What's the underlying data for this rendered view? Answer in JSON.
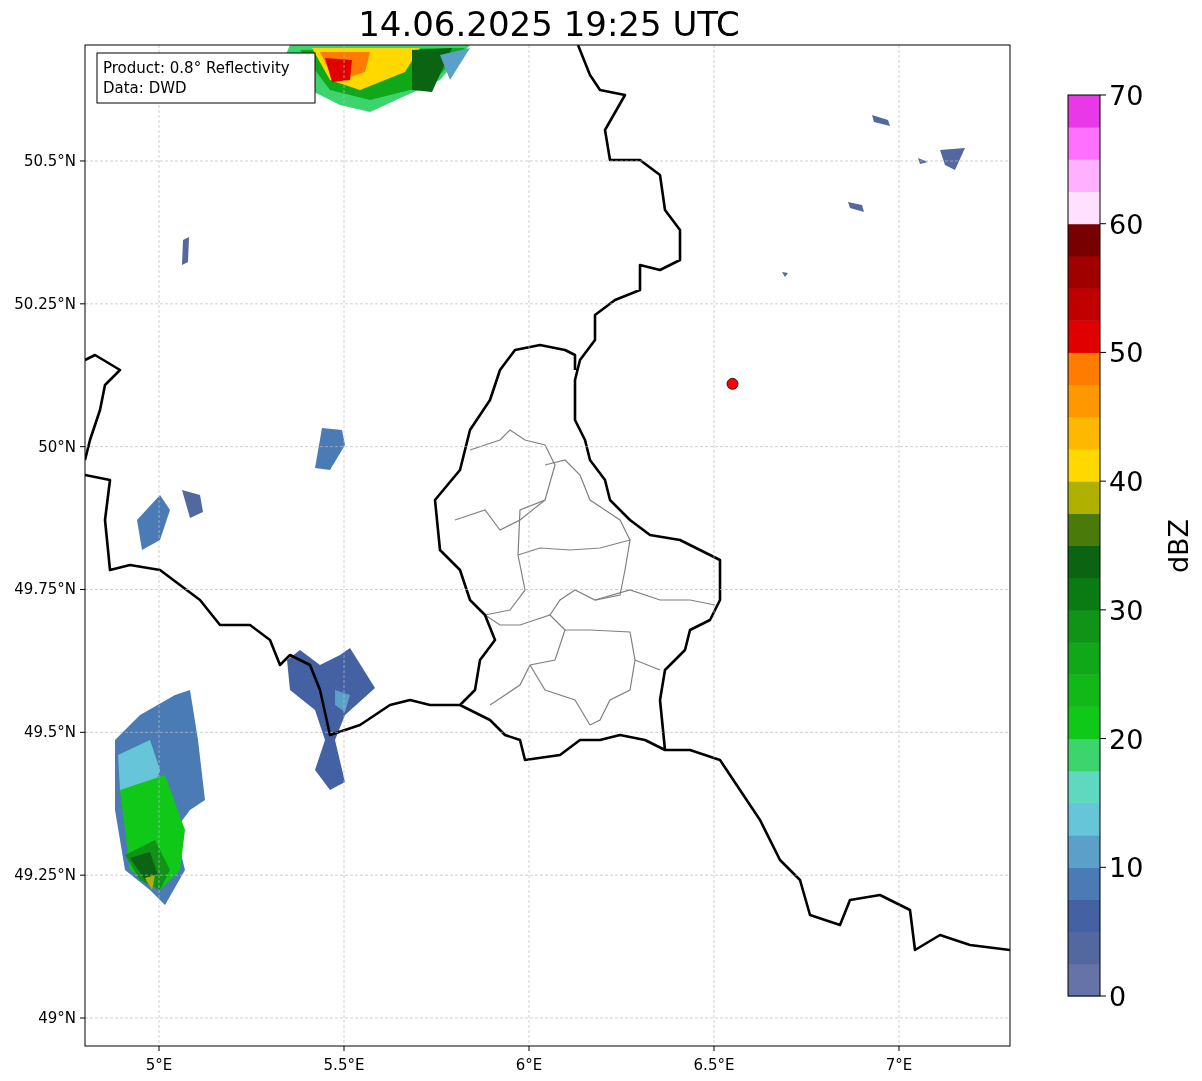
{
  "title": "14.06.2025 19:25 UTC",
  "info_box": {
    "lines": [
      "Product: 0.8° Reflectivity",
      "Data: DWD"
    ]
  },
  "map": {
    "chart_data": {
      "type": "scatter",
      "xlim": [
        4.8,
        7.3
      ],
      "ylim": [
        48.951,
        50.703
      ],
      "xticks": [
        {
          "value": 5,
          "label": "5°E"
        },
        {
          "value": 5.5,
          "label": "5.5°E"
        },
        {
          "value": 6,
          "label": "6°E"
        },
        {
          "value": 6.5,
          "label": "6.5°E"
        },
        {
          "value": 7,
          "label": "7°E"
        }
      ],
      "yticks": [
        {
          "value": 49,
          "label": "49°N"
        },
        {
          "value": 49.25,
          "label": "49.25°N"
        },
        {
          "value": 49.5,
          "label": "49.5°N"
        },
        {
          "value": 49.75,
          "label": "49.75°N"
        },
        {
          "value": 50,
          "label": "50°N"
        },
        {
          "value": 50.25,
          "label": "50.25°N"
        },
        {
          "value": 50.5,
          "label": "50.5°N"
        }
      ],
      "grid": true,
      "series": [
        {
          "color": "#ff0000",
          "x": [
            6.55
          ],
          "values": [
            50.11
          ]
        }
      ]
    }
  },
  "colorbar": {
    "label": "dBZ",
    "ticks": [
      "70",
      "60",
      "50",
      "40",
      "30",
      "20",
      "10",
      "0"
    ],
    "bins": [
      {
        "color": "#6673a8"
      },
      {
        "color": "#5468a0"
      },
      {
        "color": "#4361a3"
      },
      {
        "color": "#4a7bb5"
      },
      {
        "color": "#5ba0c8"
      },
      {
        "color": "#66c5d9"
      },
      {
        "color": "#5fd8c0"
      },
      {
        "color": "#3cd46c"
      },
      {
        "color": "#10c818"
      },
      {
        "color": "#10b818"
      },
      {
        "color": "#10a818"
      },
      {
        "color": "#109418"
      },
      {
        "color": "#0a7a12"
      },
      {
        "color": "#0a6412"
      },
      {
        "color": "#4a7a0a"
      },
      {
        "color": "#b0b000"
      },
      {
        "color": "#ffd800"
      },
      {
        "color": "#ffb800"
      },
      {
        "color": "#ff9800"
      },
      {
        "color": "#ff7c00"
      },
      {
        "color": "#e00000"
      },
      {
        "color": "#c00000"
      },
      {
        "color": "#a00000"
      },
      {
        "color": "#780000"
      },
      {
        "color": "#ffe0ff"
      },
      {
        "color": "#ffb0ff"
      },
      {
        "color": "#ff70ff"
      },
      {
        "color": "#e838e8"
      }
    ]
  }
}
